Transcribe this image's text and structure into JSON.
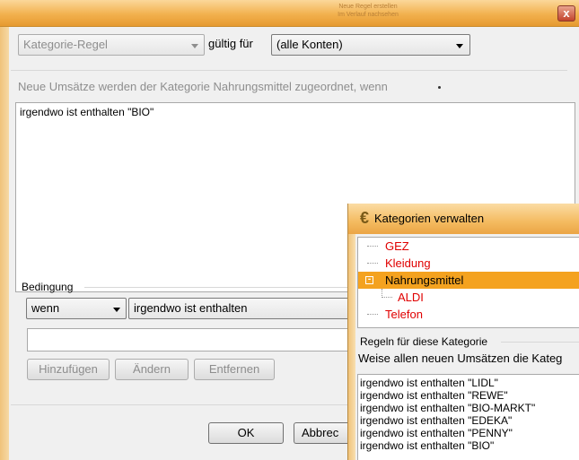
{
  "window": {
    "faint_title_line1": "Neue Regel erstellen",
    "faint_title_line2": "Im Verlauf nachsehen",
    "close_glyph": "x"
  },
  "rule_header": {
    "rule_type": "Kategorie-Regel",
    "valid_for_label": "gültig für",
    "accounts_value": "(alle Konten)"
  },
  "description": "Neue Umsätze werden der Kategorie Nahrungsmittel zugeordnet, wenn",
  "rules_text": "irgendwo ist enthalten \"BIO\"",
  "condition": {
    "group_label": "Bedingung",
    "operator": "wenn",
    "match_type": "irgendwo ist enthalten",
    "value": "",
    "add_button": "Hinzufügen",
    "change_button": "Ändern",
    "remove_button": "Entfernen"
  },
  "footer": {
    "ok_button": "OK",
    "cancel_button": "Abbrec"
  },
  "popup": {
    "title": "Kategorien verwalten",
    "categories": [
      {
        "label": "GEZ",
        "level": 0,
        "selected": false,
        "color": "#e00000"
      },
      {
        "label": "Kleidung",
        "level": 0,
        "selected": false,
        "color": "#e00000"
      },
      {
        "label": "Nahrungsmittel",
        "level": 0,
        "selected": true,
        "color": "#000000",
        "expander": "-"
      },
      {
        "label": "ALDI",
        "level": 1,
        "selected": false,
        "color": "#e00000"
      },
      {
        "label": "Telefon",
        "level": 0,
        "selected": false,
        "color": "#e00000"
      }
    ],
    "rules_group_label": "Regeln für diese Kategorie",
    "rules_description": "Weise allen neuen Umsätzen die Kateg",
    "rules": [
      "irgendwo ist enthalten \"LIDL\"",
      "irgendwo ist enthalten \"REWE\"",
      "irgendwo ist enthalten \"BIO-MARKT\"",
      "irgendwo ist enthalten \"EDEKA\"",
      "irgendwo ist enthalten \"PENNY\"",
      "irgendwo ist enthalten \"BIO\""
    ]
  },
  "colors": {
    "title_orange": "#f2b14e",
    "selected_orange": "#f4a21f",
    "category_red": "#e00000"
  }
}
